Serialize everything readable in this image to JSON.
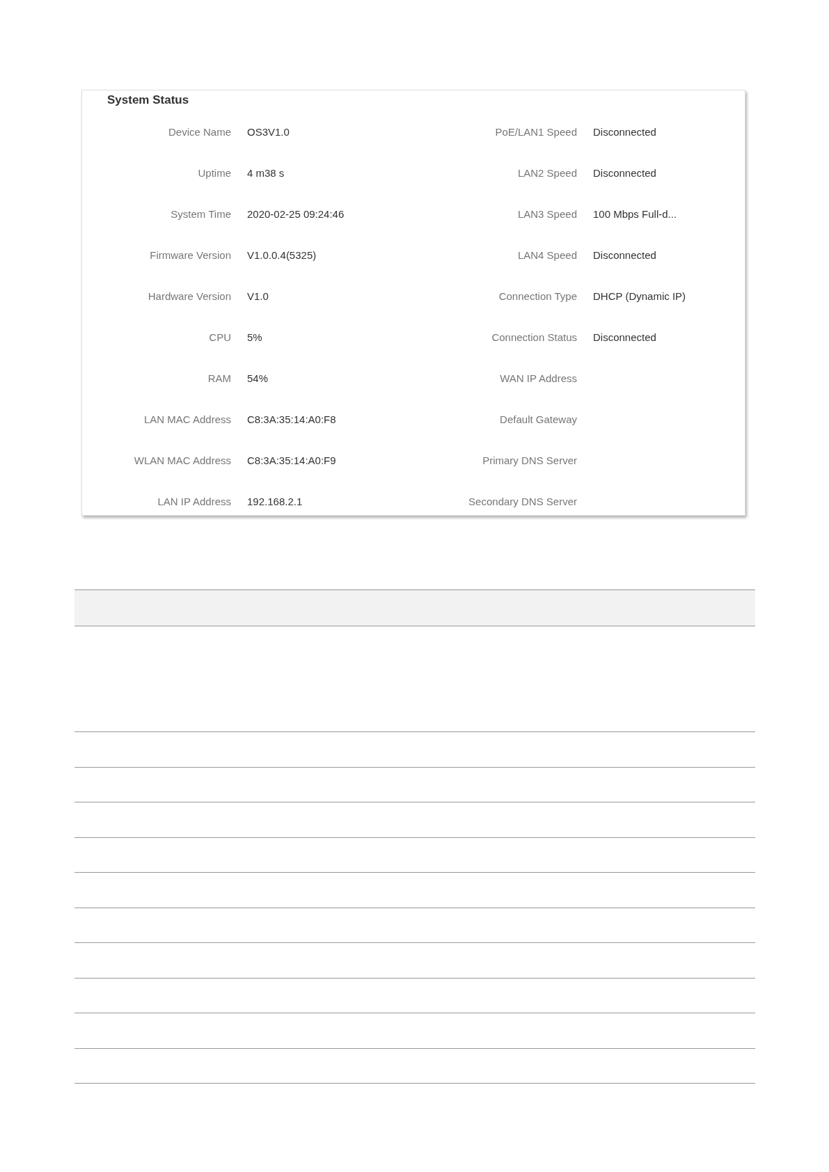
{
  "panel": {
    "title": "System Status",
    "left": [
      {
        "label": "Device Name",
        "value": "OS3V1.0"
      },
      {
        "label": "Uptime",
        "value": "4 m38 s"
      },
      {
        "label": "System Time",
        "value": "2020-02-25 09:24:46"
      },
      {
        "label": "Firmware Version",
        "value": "V1.0.0.4(5325)"
      },
      {
        "label": "Hardware Version",
        "value": "V1.0"
      },
      {
        "label": "CPU",
        "value": "5%"
      },
      {
        "label": "RAM",
        "value": "54%"
      },
      {
        "label": "LAN MAC Address",
        "value": "C8:3A:35:14:A0:F8"
      },
      {
        "label": "WLAN MAC Address",
        "value": "C8:3A:35:14:A0:F9"
      },
      {
        "label": "LAN IP Address",
        "value": "192.168.2.1"
      }
    ],
    "right": [
      {
        "label": "PoE/LAN1 Speed",
        "value": "Disconnected"
      },
      {
        "label": "LAN2 Speed",
        "value": "Disconnected"
      },
      {
        "label": "LAN3 Speed",
        "value": "100 Mbps Full-d..."
      },
      {
        "label": "LAN4 Speed",
        "value": "Disconnected"
      },
      {
        "label": "Connection Type",
        "value": "DHCP (Dynamic IP)"
      },
      {
        "label": "Connection Status",
        "value": "Disconnected"
      },
      {
        "label": "WAN IP Address"
      },
      {
        "label": "Default Gateway"
      },
      {
        "label": "Primary DNS Server"
      },
      {
        "label": "Secondary DNS Server"
      }
    ]
  }
}
